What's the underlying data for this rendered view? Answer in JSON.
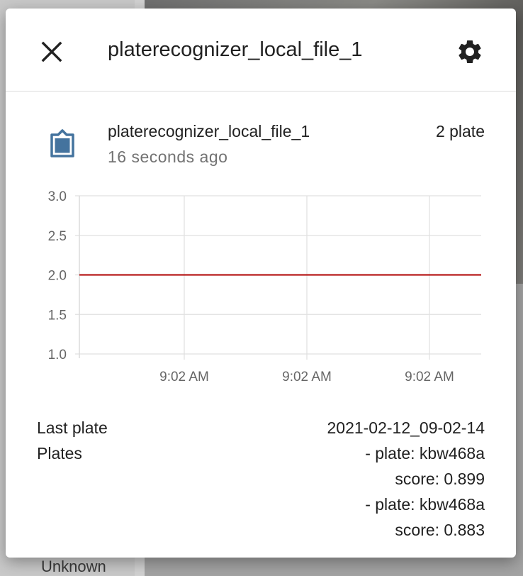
{
  "background": {
    "partial_text": "Unknown"
  },
  "dialog": {
    "title": "platerecognizer_local_file_1",
    "close_icon": "close-icon",
    "settings_icon": "gear-icon"
  },
  "entity": {
    "icon": "clipboard-icon",
    "name": "platerecognizer_local_file_1",
    "state": "2 plate",
    "last_changed": "16 seconds ago"
  },
  "chart_data": {
    "type": "line",
    "title": "",
    "xlabel": "",
    "ylabel": "",
    "ylim": [
      1.0,
      3.0
    ],
    "y_ticks": [
      "3.0",
      "2.5",
      "2.0",
      "1.5",
      "1.0"
    ],
    "x_tick_labels": [
      "9:02 AM",
      "9:02 AM",
      "9:02 AM"
    ],
    "series": [
      {
        "values": [
          2.0,
          2.0
        ],
        "color": "#b71c1c"
      }
    ],
    "grid": true
  },
  "attributes": [
    {
      "label": "Last plate",
      "values": [
        "2021-02-12_09-02-14"
      ]
    },
    {
      "label": "Plates",
      "values": [
        "- plate: kbw468a",
        "score: 0.899",
        "- plate: kbw468a",
        "score: 0.883"
      ]
    }
  ],
  "colors": {
    "icon": "#44739e",
    "line": "#b71c1c",
    "grid": "#e0e0e0"
  }
}
